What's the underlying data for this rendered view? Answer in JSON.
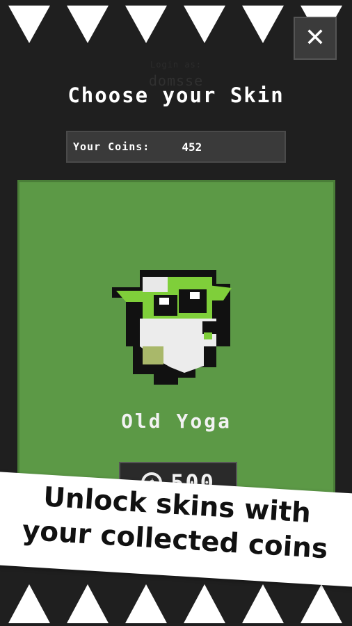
{
  "header": {
    "login_label": "Login as:",
    "username": "domsse",
    "title": "Choose your Skin",
    "close_label": "✕"
  },
  "coins": {
    "label": "Your Coins:",
    "value": "452"
  },
  "skin": {
    "name": "Old Yoga",
    "price": "500",
    "panel_color": "#5c9946"
  },
  "promo": {
    "line1": "Unlock skins with",
    "line2": "your collected coins"
  }
}
